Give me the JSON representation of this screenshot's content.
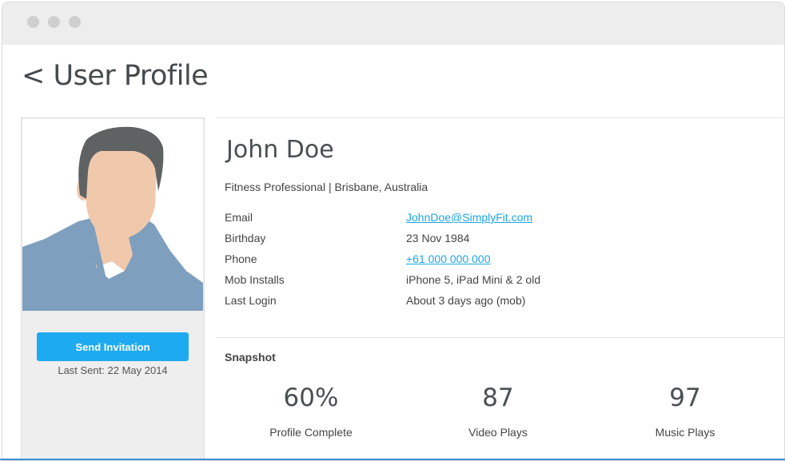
{
  "page": {
    "title": "User Profile",
    "back_symbol": "<"
  },
  "profile": {
    "name": "John Doe",
    "subtitle": "Fitness Professional | Brisbane, Australia",
    "details": [
      {
        "label": "Email",
        "value": "JohnDoe@SimplyFit.com",
        "link": true
      },
      {
        "label": "Birthday",
        "value": "23 Nov 1984",
        "link": false
      },
      {
        "label": "Phone",
        "value": "+61 000 000 000",
        "link": true
      },
      {
        "label": "Mob Installs",
        "value": "iPhone 5, iPad Mini & 2 old",
        "link": false
      },
      {
        "label": "Last Login",
        "value": "About 3 days ago (mob)",
        "link": false
      }
    ]
  },
  "sidebar": {
    "send_button_label": "Send Invitation",
    "last_sent": "Last Sent: 22 May 2014"
  },
  "snapshot": {
    "title": "Snapshot",
    "stats": [
      {
        "value": "60%",
        "label": "Profile Complete"
      },
      {
        "value": "87",
        "label": "Video Plays"
      },
      {
        "value": "97",
        "label": "Music Plays"
      }
    ]
  },
  "colors": {
    "accent": "#1eaaf1",
    "link": "#1ea5e4",
    "avatar_shirt": "#7f9fbe",
    "avatar_skin": "#f0c8ac",
    "avatar_hair": "#5f6263"
  },
  "icons": {
    "avatar": "user-avatar-illustration"
  }
}
